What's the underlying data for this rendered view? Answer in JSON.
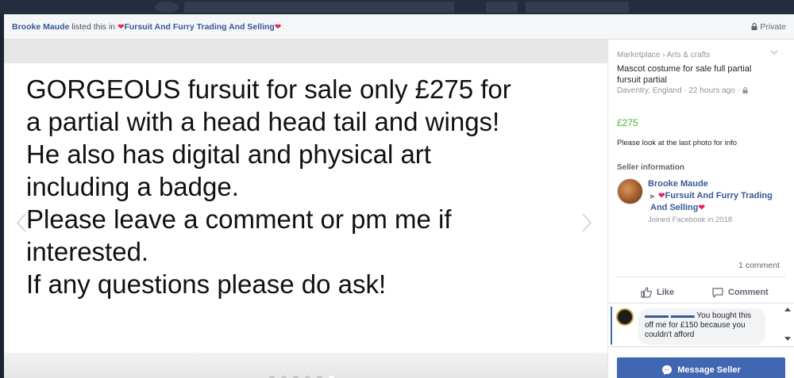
{
  "header": {
    "seller_name": "Brooke Maude",
    "listed_text": "listed this in",
    "group_name": "Fursuit And Furry Trading And Selling",
    "privacy": "Private"
  },
  "photo": {
    "lines": [
      "GORGEOUS fursuit for sale only £275 for",
      "a partial with a head head tail and wings!",
      "He also has digital and physical art",
      "including a badge.",
      "Please leave a comment or pm me if",
      "interested.",
      "If any questions please do ask!"
    ],
    "dot_count": 6,
    "active_dot": 6
  },
  "panel": {
    "breadcrumb": "Marketplace › Arts & crafts",
    "title": "Mascot costume for sale full partial fursuit partial",
    "location": "Daventry, England · 22 hours ago ·",
    "price": "£275",
    "description": "Please look at the last photo for info",
    "seller_heading": "Seller information",
    "seller_name": "Brooke Maude",
    "group_name": "Fursuit And Furry Trading And Selling",
    "joined": "Joined Facebook in 2018",
    "comment_count": "1 comment",
    "like_label": "Like",
    "comment_label": "Comment",
    "comment_text": "You bought this off me for £150 because you couldn't afford",
    "message_button": "Message Seller"
  },
  "icons": {
    "heart": "heart-icon",
    "lock": "lock-icon",
    "like": "thumbs-up-icon",
    "comment": "comment-bubble-icon",
    "messenger": "messenger-icon"
  },
  "colors": {
    "link": "#385898",
    "price": "#42b72a",
    "button": "#4267b2",
    "heart": "#e0245e"
  }
}
